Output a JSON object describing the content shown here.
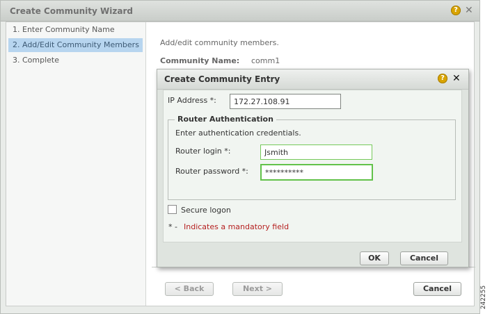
{
  "wizard": {
    "title": "Create Community Wizard",
    "help_icon": "question-icon",
    "close_icon": "close-icon",
    "steps": [
      {
        "label": "1. Enter Community Name",
        "active": false
      },
      {
        "label": "2. Add/Edit Community Members",
        "active": true
      },
      {
        "label": "3. Complete",
        "active": false
      }
    ],
    "intro_text": "Add/edit community members.",
    "community_name_label": "Community Name:",
    "community_name_value": "comm1",
    "buttons": {
      "back": "< Back",
      "next": "Next >",
      "cancel": "Cancel"
    }
  },
  "dialog": {
    "title": "Create Community Entry",
    "help_icon": "question-icon",
    "close_icon": "close-icon",
    "ip_label": "IP Address *:",
    "ip_value": "172.27.108.91",
    "router_auth": {
      "legend": "Router Authentication",
      "instruction": "Enter authentication credentials.",
      "login_label": "Router login *:",
      "login_value": "Jsmith",
      "password_label": "Router password *:",
      "password_value": "**********"
    },
    "secure_logon_label": "Secure logon",
    "secure_logon_checked": false,
    "mandatory_star": "* -",
    "mandatory_text": "Indicates a mandatory field",
    "buttons": {
      "ok": "OK",
      "cancel": "Cancel"
    }
  },
  "figure_id": "242255",
  "colors": {
    "active_step_bg": "#b7d5ef",
    "mandatory_text": "#b51f1f",
    "focus_border": "#62c24a",
    "help_icon": "#d9a400"
  }
}
